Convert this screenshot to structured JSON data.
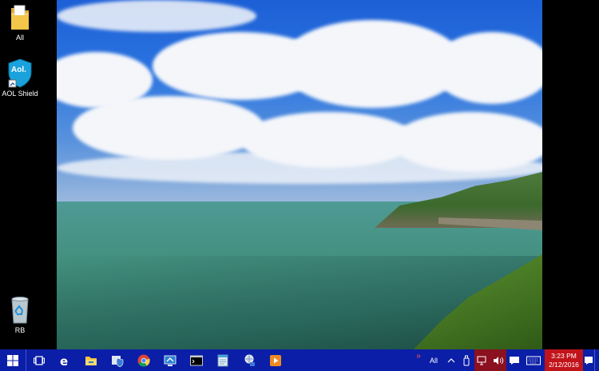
{
  "desktop": {
    "icons": [
      {
        "label": "All",
        "icon": "folder-icon"
      },
      {
        "label": "AOL Shield",
        "icon": "aol-shield-icon",
        "logo_text": "Aol."
      },
      {
        "label": "RB",
        "icon": "recycle-bin-icon"
      }
    ]
  },
  "wallpaper": {
    "description_icon": "coastal-seascape-wallpaper"
  },
  "taskbar": {
    "start": "windows-start-icon",
    "task_view": "task-view-icon",
    "pinned": [
      {
        "name": "edge",
        "icon": "edge-icon"
      },
      {
        "name": "file-explorer",
        "icon": "file-explorer-icon"
      },
      {
        "name": "security",
        "icon": "security-shield-icon"
      },
      {
        "name": "chrome",
        "icon": "chrome-icon"
      },
      {
        "name": "remote-desktop",
        "icon": "remote-desktop-icon"
      },
      {
        "name": "command-prompt",
        "icon": "command-prompt-icon"
      },
      {
        "name": "notepad",
        "icon": "notepad-icon"
      },
      {
        "name": "network",
        "icon": "network-icon"
      },
      {
        "name": "media-player",
        "icon": "media-player-icon"
      }
    ],
    "tray": {
      "toolbar_chevron": "»",
      "toolbar_label": "All",
      "clock_time": "3:23 PM",
      "clock_date": "2/12/2016"
    },
    "colors": {
      "bar": "#0b1ea8",
      "clock": "#c1141a"
    }
  }
}
